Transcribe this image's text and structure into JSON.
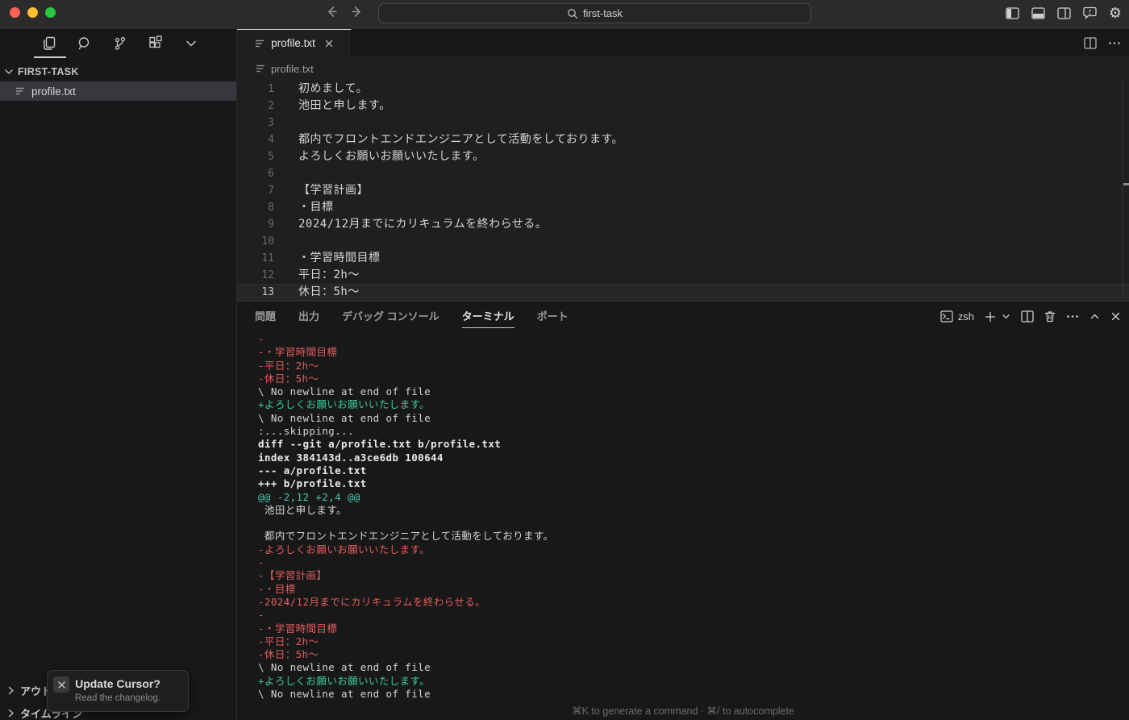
{
  "window": {
    "search": {
      "value": "first-task"
    },
    "traffic_colors": {
      "close": "#ff5f57",
      "minimize": "#febc2e",
      "zoom": "#28c840"
    },
    "right_icons": [
      "toggle-left-sidebar",
      "toggle-panel",
      "toggle-right-sidebar",
      "feedback",
      "settings"
    ]
  },
  "activity_bar": {
    "icons": [
      "explorer",
      "search",
      "source-control",
      "extensions",
      "more-views"
    ],
    "active": "explorer"
  },
  "sidebar": {
    "explorer_title": "FIRST-TASK",
    "files": [
      {
        "name": "profile.txt",
        "selected": true
      }
    ],
    "bottom_sections": [
      {
        "label": "アウトライン"
      },
      {
        "label": "タイムライン"
      }
    ]
  },
  "editor": {
    "tab": {
      "name": "profile.txt"
    },
    "breadcrumb_file": "profile.txt",
    "lines": [
      {
        "n": 1,
        "text": "初めまして。"
      },
      {
        "n": 2,
        "text": "池田と申します。"
      },
      {
        "n": 3,
        "text": ""
      },
      {
        "n": 4,
        "text": "都内でフロントエンドエンジニアとして活動をしております。"
      },
      {
        "n": 5,
        "text": "よろしくお願いお願いいたします。"
      },
      {
        "n": 6,
        "text": ""
      },
      {
        "n": 7,
        "text": "【学習計画】"
      },
      {
        "n": 8,
        "text": "・目標"
      },
      {
        "n": 9,
        "text": "2024/12月までにカリキュラムを終わらせる。"
      },
      {
        "n": 10,
        "text": ""
      },
      {
        "n": 11,
        "text": "・学習時間目標"
      },
      {
        "n": 12,
        "text": "平日：2h〜"
      },
      {
        "n": 13,
        "text": "休日：5h〜",
        "current": true
      }
    ]
  },
  "panel": {
    "tabs": [
      {
        "label": "問題"
      },
      {
        "label": "出力"
      },
      {
        "label": "デバッグ コンソール"
      },
      {
        "label": "ターミナル",
        "active": true
      },
      {
        "label": "ポート"
      }
    ],
    "shell_label": "zsh",
    "action_icons": [
      "terminal-shell",
      "new-terminal",
      "terminal-dropdown",
      "split-terminal",
      "kill-terminal",
      "more-actions",
      "maximize-panel",
      "close-panel"
    ],
    "terminal_lines": [
      {
        "kind": "removed",
        "text": "-"
      },
      {
        "kind": "removed",
        "text": "-・学習時間目標"
      },
      {
        "kind": "removed",
        "text": "-平日：2h〜"
      },
      {
        "kind": "removed",
        "text": "-休日：5h〜"
      },
      {
        "kind": "plain",
        "text": "\\ No newline at end of file"
      },
      {
        "kind": "added",
        "text": "+よろしくお願いお願いいたします。"
      },
      {
        "kind": "plain",
        "text": "\\ No newline at end of file"
      },
      {
        "kind": "plain",
        "text": ":...skipping..."
      },
      {
        "kind": "meta",
        "text": "diff --git a/profile.txt b/profile.txt"
      },
      {
        "kind": "meta",
        "text": "index 384143d..a3ce6db 100644"
      },
      {
        "kind": "meta",
        "text": "--- a/profile.txt"
      },
      {
        "kind": "meta",
        "text": "+++ b/profile.txt"
      },
      {
        "kind": "hunk",
        "text": "@@ -2,12 +2,4 @@"
      },
      {
        "kind": "plain",
        "text": " 池田と申します。"
      },
      {
        "kind": "plain",
        "text": ""
      },
      {
        "kind": "plain",
        "text": " 都内でフロントエンドエンジニアとして活動をしております。"
      },
      {
        "kind": "removed",
        "text": "-よろしくお願いお願いいたします。"
      },
      {
        "kind": "removed",
        "text": "-"
      },
      {
        "kind": "removed",
        "text": "-【学習計画】"
      },
      {
        "kind": "removed",
        "text": "-・目標"
      },
      {
        "kind": "removed",
        "text": "-2024/12月までにカリキュラムを終わらせる。"
      },
      {
        "kind": "removed",
        "text": "-"
      },
      {
        "kind": "removed",
        "text": "-・学習時間目標"
      },
      {
        "kind": "removed",
        "text": "-平日：2h〜"
      },
      {
        "kind": "removed",
        "text": "-休日：5h〜"
      },
      {
        "kind": "plain",
        "text": "\\ No newline at end of file"
      },
      {
        "kind": "added",
        "text": "+よろしくお願いお願いいたします。"
      },
      {
        "kind": "plain",
        "text": "\\ No newline at end of file"
      }
    ],
    "hint": "⌘K to generate a command · ⌘/ to autocomplete"
  },
  "notification": {
    "title": "Update Cursor?",
    "body": "Read the changelog."
  },
  "colors": {
    "diff_removed": "#e25d5d",
    "diff_added": "#3bc99c",
    "diff_hunk": "#45c8b0",
    "editor_bg": "#1f1f1f",
    "panel_bg": "#181818",
    "titlebar_bg": "#2b2b2b",
    "selection_row": "#37373d"
  }
}
